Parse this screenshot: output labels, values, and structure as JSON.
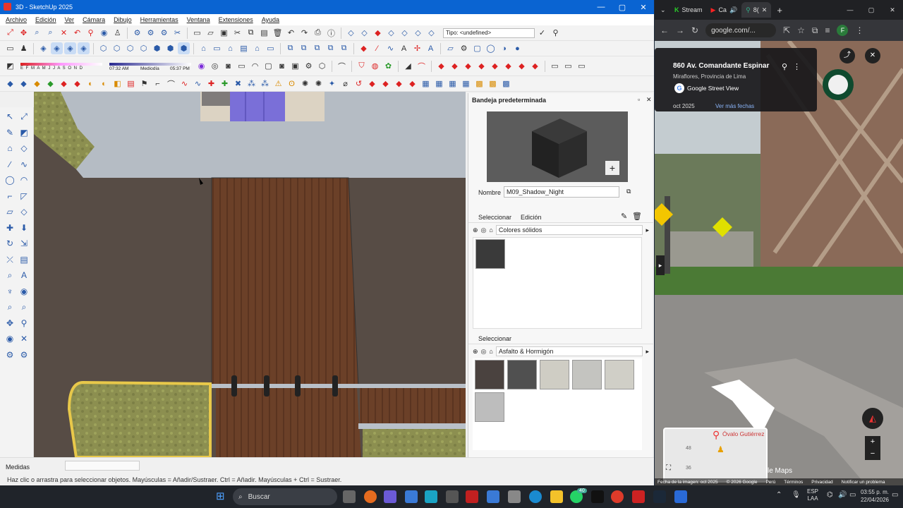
{
  "sketchup": {
    "title": "3D - SketchUp 2025",
    "menu": [
      "Archivo",
      "Edición",
      "Ver",
      "Cámara",
      "Dibujo",
      "Herramientas",
      "Ventana",
      "Extensiones",
      "Ayuda"
    ],
    "tipo": "Tipo: <undefined>",
    "shadow_months": "E F M A M J J A S O N D",
    "time_start": "07:32 AM",
    "time_mid": "Mediodía",
    "time_end": "05:37 PM",
    "tray": {
      "title": "Bandeja predeterminada",
      "name_label": "Nombre",
      "material_name": "M09_Shadow_Night",
      "tab_select": "Seleccionar",
      "tab_edit": "Edición",
      "library1": "Colores sólidos",
      "section2_label": "Seleccionar",
      "library2": "Asfalto & Hormigón"
    },
    "measurements_label": "Medidas",
    "status_hint": "Haz clic o arrastra para seleccionar objetos. Mayúsculas = Añadir/Sustraer. Ctrl = Añadir. Mayúsculas + Ctrl = Sustraer."
  },
  "chrome": {
    "tabs": [
      {
        "label": "Stream",
        "active": false
      },
      {
        "label": "Ca",
        "active": false
      },
      {
        "label": "8(",
        "active": true
      }
    ],
    "url": "google.com/...",
    "profile": "F",
    "sv": {
      "address": "860 Av. Comandante Espinar",
      "locality": "Miraflores, Provincia de Lima",
      "brand": "Google Street View",
      "date": "oct 2025",
      "more_dates": "Ver más fechas",
      "map_place": "Óvalo Gutiérrez",
      "map_numbers": [
        "48",
        "36"
      ],
      "maps_label": "le Maps",
      "footer": [
        "Fecha de la imagen: oct 2025",
        "© 2026 Google",
        "Perú",
        "Términos",
        "Privacidad",
        "Notificar un problema"
      ]
    }
  },
  "taskbar": {
    "search": "Buscar",
    "lang1": "ESP",
    "lang2": "LAA",
    "time": "03:55 p. m.",
    "date": "22/04/2026",
    "badge": "40"
  },
  "colors": {
    "sketchup_title": "#0a64d2",
    "chrome_bg": "#202124",
    "taskbar": "#20242a"
  }
}
